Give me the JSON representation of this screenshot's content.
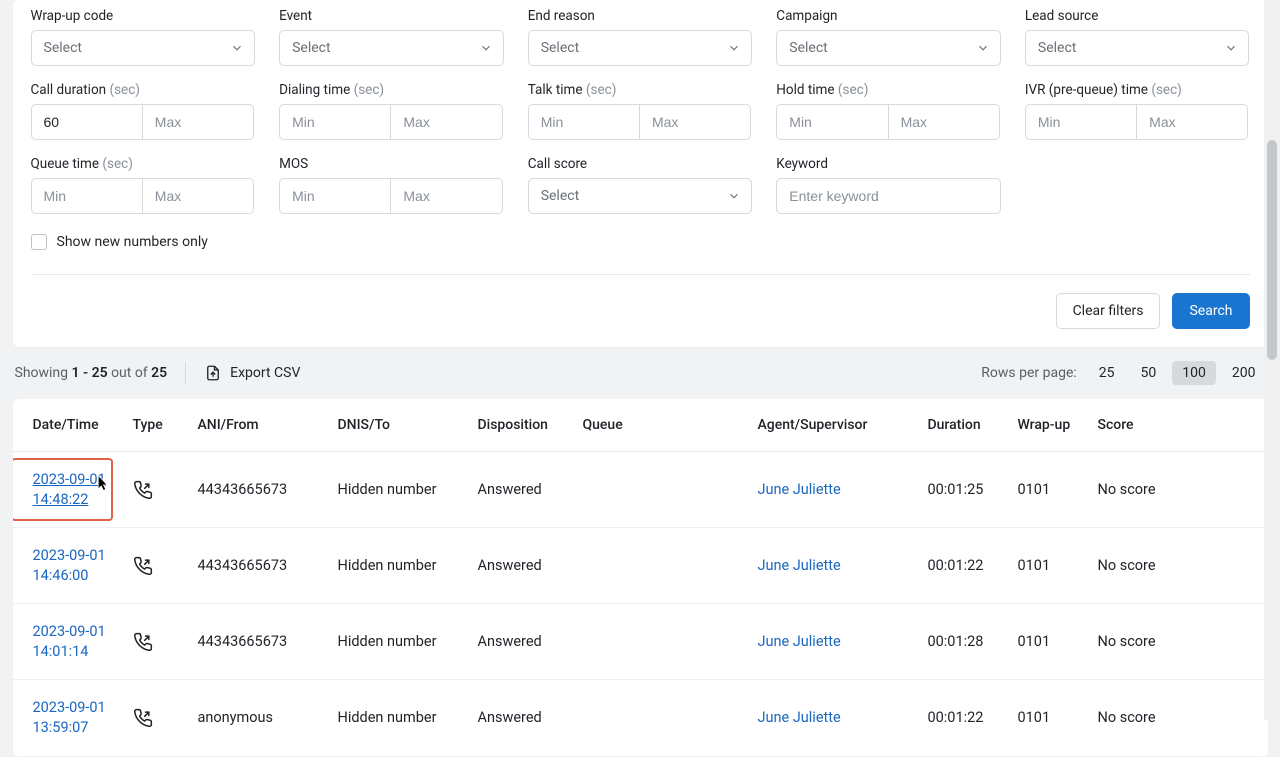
{
  "filters": {
    "row1": {
      "wrapup": {
        "label": "Wrap-up code",
        "placeholder": "Select"
      },
      "event": {
        "label": "Event",
        "placeholder": "Select"
      },
      "endreason": {
        "label": "End reason",
        "placeholder": "Select"
      },
      "campaign": {
        "label": "Campaign",
        "placeholder": "Select"
      },
      "lead": {
        "label": "Lead source",
        "placeholder": "Select"
      }
    },
    "row2": {
      "call_duration": {
        "label": "Call duration ",
        "sec": "(sec)",
        "min": "60",
        "max_ph": "Max"
      },
      "dialing_time": {
        "label": "Dialing time ",
        "sec": "(sec)",
        "min_ph": "Min",
        "max_ph": "Max"
      },
      "talk_time": {
        "label": "Talk time ",
        "sec": "(sec)",
        "min_ph": "Min",
        "max_ph": "Max"
      },
      "hold_time": {
        "label": "Hold time ",
        "sec": "(sec)",
        "min_ph": "Min",
        "max_ph": "Max"
      },
      "ivr_time": {
        "label": "IVR (pre-queue) time ",
        "sec": "(sec)",
        "min_ph": "Min",
        "max_ph": "Max"
      }
    },
    "row3": {
      "queue_time": {
        "label": "Queue time ",
        "sec": "(sec)",
        "min_ph": "Min",
        "max_ph": "Max"
      },
      "mos": {
        "label": "MOS",
        "sec": "",
        "min_ph": "Min",
        "max_ph": "Max"
      },
      "call_score": {
        "label": "Call score",
        "placeholder": "Select"
      },
      "keyword": {
        "label": "Keyword",
        "placeholder": "Enter keyword"
      }
    },
    "checkbox_label": "Show new numbers only",
    "clear_label": "Clear filters",
    "search_label": "Search"
  },
  "results": {
    "showing_prefix": "Showing ",
    "range": "1 - 25",
    "out_of": " out of ",
    "total": "25",
    "export_label": "Export CSV",
    "rpp_label": "Rows per page:",
    "sizes": [
      "25",
      "50",
      "100",
      "200"
    ],
    "active_size": "100"
  },
  "table": {
    "cols": {
      "datetime": "Date/Time",
      "type": "Type",
      "ani": "ANI/From",
      "dnis": "DNIS/To",
      "disp": "Disposition",
      "queue": "Queue",
      "agent": "Agent/Supervisor",
      "duration": "Duration",
      "wrapup": "Wrap-up",
      "score": "Score"
    },
    "rows": [
      {
        "dt1": "2023-09-01",
        "dt2": "14:48:22",
        "ani": "44343665673",
        "dnis": "Hidden number",
        "disp": "Answered",
        "queue": "",
        "agent": "June Juliette",
        "dur": "00:01:25",
        "wrap": "0101",
        "score": "No score",
        "hl": true
      },
      {
        "dt1": "2023-09-01",
        "dt2": "14:46:00",
        "ani": "44343665673",
        "dnis": "Hidden number",
        "disp": "Answered",
        "queue": "",
        "agent": "June Juliette",
        "dur": "00:01:22",
        "wrap": "0101",
        "score": "No score"
      },
      {
        "dt1": "2023-09-01",
        "dt2": "14:01:14",
        "ani": "44343665673",
        "dnis": "Hidden number",
        "disp": "Answered",
        "queue": "",
        "agent": "June Juliette",
        "dur": "00:01:28",
        "wrap": "0101",
        "score": "No score"
      },
      {
        "dt1": "2023-09-01",
        "dt2": "13:59:07",
        "ani": "anonymous",
        "dnis": "Hidden number",
        "disp": "Answered",
        "queue": "",
        "agent": "June Juliette",
        "dur": "00:01:22",
        "wrap": "0101",
        "score": "No score"
      }
    ]
  }
}
